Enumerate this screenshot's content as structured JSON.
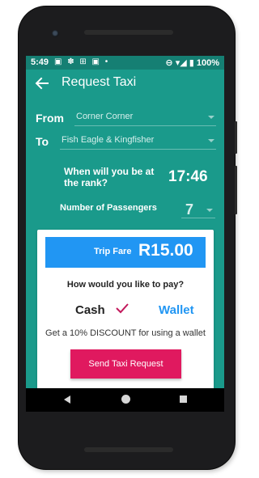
{
  "status_bar": {
    "time": "5:49",
    "notification_icons": "▣ ✽ ⊞ ▣ •",
    "right_icons": "⊖ ▾◢ ▮",
    "battery": "100%"
  },
  "appbar": {
    "title": "Request Taxi",
    "back_icon": "arrow-left-icon"
  },
  "form": {
    "from_label": "From",
    "from_value": "Corner Corner",
    "to_label": "To",
    "to_value": "Fish Eagle & Kingfisher",
    "rank_question": "When will you be at the rank?",
    "rank_time": "17:46",
    "passengers_label": "Number of Passengers",
    "passengers_value": "7"
  },
  "card": {
    "fare_label": "Trip Fare",
    "fare_amount": "R15.00",
    "pay_question": "How would you like to pay?",
    "cash_label": "Cash",
    "wallet_label": "Wallet",
    "discount_text": "Get a 10% DISCOUNT for using a wallet",
    "send_button": "Send Taxi Request"
  },
  "colors": {
    "primary": "#1a9a8b",
    "status_bar": "#157f73",
    "fare_blue": "#2196f3",
    "accent_pink": "#e0195f",
    "check_color": "#c2185b"
  }
}
